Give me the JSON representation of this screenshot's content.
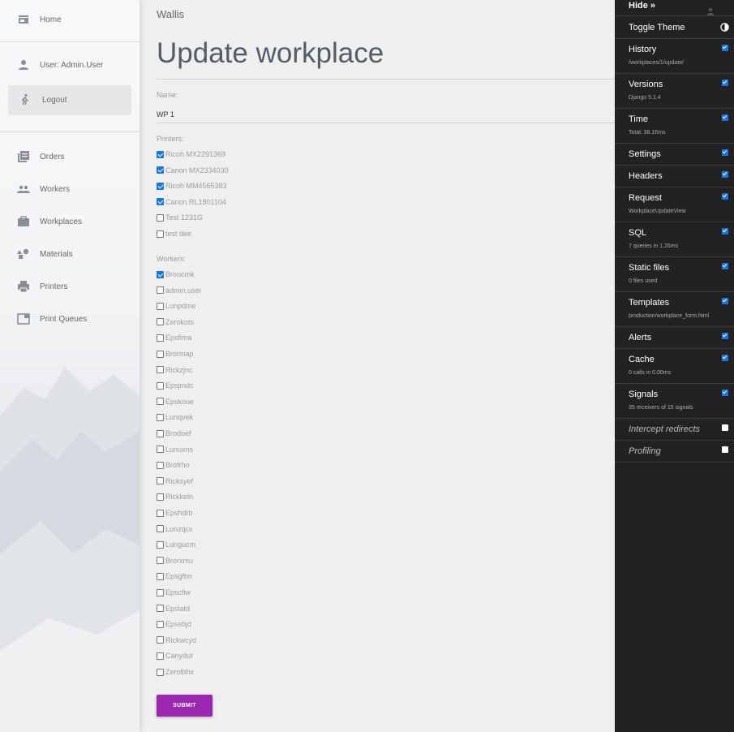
{
  "sidebar": {
    "home": "Home",
    "user": "User: Admin.User",
    "logout": "Logout",
    "items": [
      {
        "label": "Orders",
        "icon": "orders-icon"
      },
      {
        "label": "Workers",
        "icon": "workers-icon"
      },
      {
        "label": "Workplaces",
        "icon": "workplaces-icon"
      },
      {
        "label": "Materials",
        "icon": "materials-icon"
      },
      {
        "label": "Printers",
        "icon": "printer-icon"
      },
      {
        "label": "Print Queues",
        "icon": "print-queue-icon"
      }
    ]
  },
  "main": {
    "brand": "Wallis",
    "title": "Update workplace",
    "name_label": "Name:",
    "name_value": "WP 1",
    "printers_label": "Printers:",
    "printers": [
      {
        "label": "Ricoh MX2291369",
        "checked": true
      },
      {
        "label": "Canon MX2334030",
        "checked": true
      },
      {
        "label": "Ricoh MM4565383",
        "checked": true
      },
      {
        "label": "Canon RL1801104",
        "checked": true
      },
      {
        "label": "Test 1231G",
        "checked": false
      },
      {
        "label": "test dee",
        "checked": false
      }
    ],
    "workers_label": "Workers:",
    "workers": [
      {
        "label": "Broucmk",
        "checked": true
      },
      {
        "label": "admin.user",
        "checked": false
      },
      {
        "label": "Lunpdme",
        "checked": false
      },
      {
        "label": "Zerokots",
        "checked": false
      },
      {
        "label": "Epsfima",
        "checked": false
      },
      {
        "label": "Brormap",
        "checked": false
      },
      {
        "label": "Rickzjnc",
        "checked": false
      },
      {
        "label": "Epsjmdc",
        "checked": false
      },
      {
        "label": "Epskoue",
        "checked": false
      },
      {
        "label": "Lunqvek",
        "checked": false
      },
      {
        "label": "Brodoef",
        "checked": false
      },
      {
        "label": "Lunuxns",
        "checked": false
      },
      {
        "label": "Brofrho",
        "checked": false
      },
      {
        "label": "Ricksyef",
        "checked": false
      },
      {
        "label": "Rickkeln",
        "checked": false
      },
      {
        "label": "Epshdrb",
        "checked": false
      },
      {
        "label": "Lunzqcx",
        "checked": false
      },
      {
        "label": "Lungucm",
        "checked": false
      },
      {
        "label": "Brorxmu",
        "checked": false
      },
      {
        "label": "Epsgfbn",
        "checked": false
      },
      {
        "label": "Epscfiw",
        "checked": false
      },
      {
        "label": "Epslatd",
        "checked": false
      },
      {
        "label": "Epssbjd",
        "checked": false
      },
      {
        "label": "Rickwcyd",
        "checked": false
      },
      {
        "label": "Canydut",
        "checked": false
      },
      {
        "label": "Zerolbhx",
        "checked": false
      }
    ],
    "submit": "SUBMIT"
  },
  "debug_toolbar": {
    "hide": "Hide »",
    "toggle_theme": "Toggle Theme",
    "panels": [
      {
        "title": "History",
        "sub": "/workplaces/1/update/",
        "checked": true
      },
      {
        "title": "Versions",
        "sub": "Django 5.1.4",
        "checked": true
      },
      {
        "title": "Time",
        "sub": "Total: 38.16ms",
        "checked": true
      },
      {
        "title": "Settings",
        "sub": "",
        "checked": true
      },
      {
        "title": "Headers",
        "sub": "",
        "checked": true
      },
      {
        "title": "Request",
        "sub": "WorkplaceUpdateView",
        "checked": true
      },
      {
        "title": "SQL",
        "sub": "7 queries in 1.26ms",
        "checked": true
      },
      {
        "title": "Static files",
        "sub": "0 files used",
        "checked": true
      },
      {
        "title": "Templates",
        "sub": "production/workplace_form.html",
        "checked": true
      },
      {
        "title": "Alerts",
        "sub": "",
        "checked": true
      },
      {
        "title": "Cache",
        "sub": "0 calls in 0.00ms",
        "checked": true
      },
      {
        "title": "Signals",
        "sub": "35 receivers of 15 signals",
        "checked": true
      },
      {
        "title": "Intercept redirects",
        "sub": "",
        "checked": false,
        "italic": true
      },
      {
        "title": "Profiling",
        "sub": "",
        "checked": false,
        "italic": true
      }
    ]
  },
  "colors": {
    "accent": "#9c27b0",
    "checkbox": "#1976e0",
    "toolbar_bg": "#222222"
  }
}
